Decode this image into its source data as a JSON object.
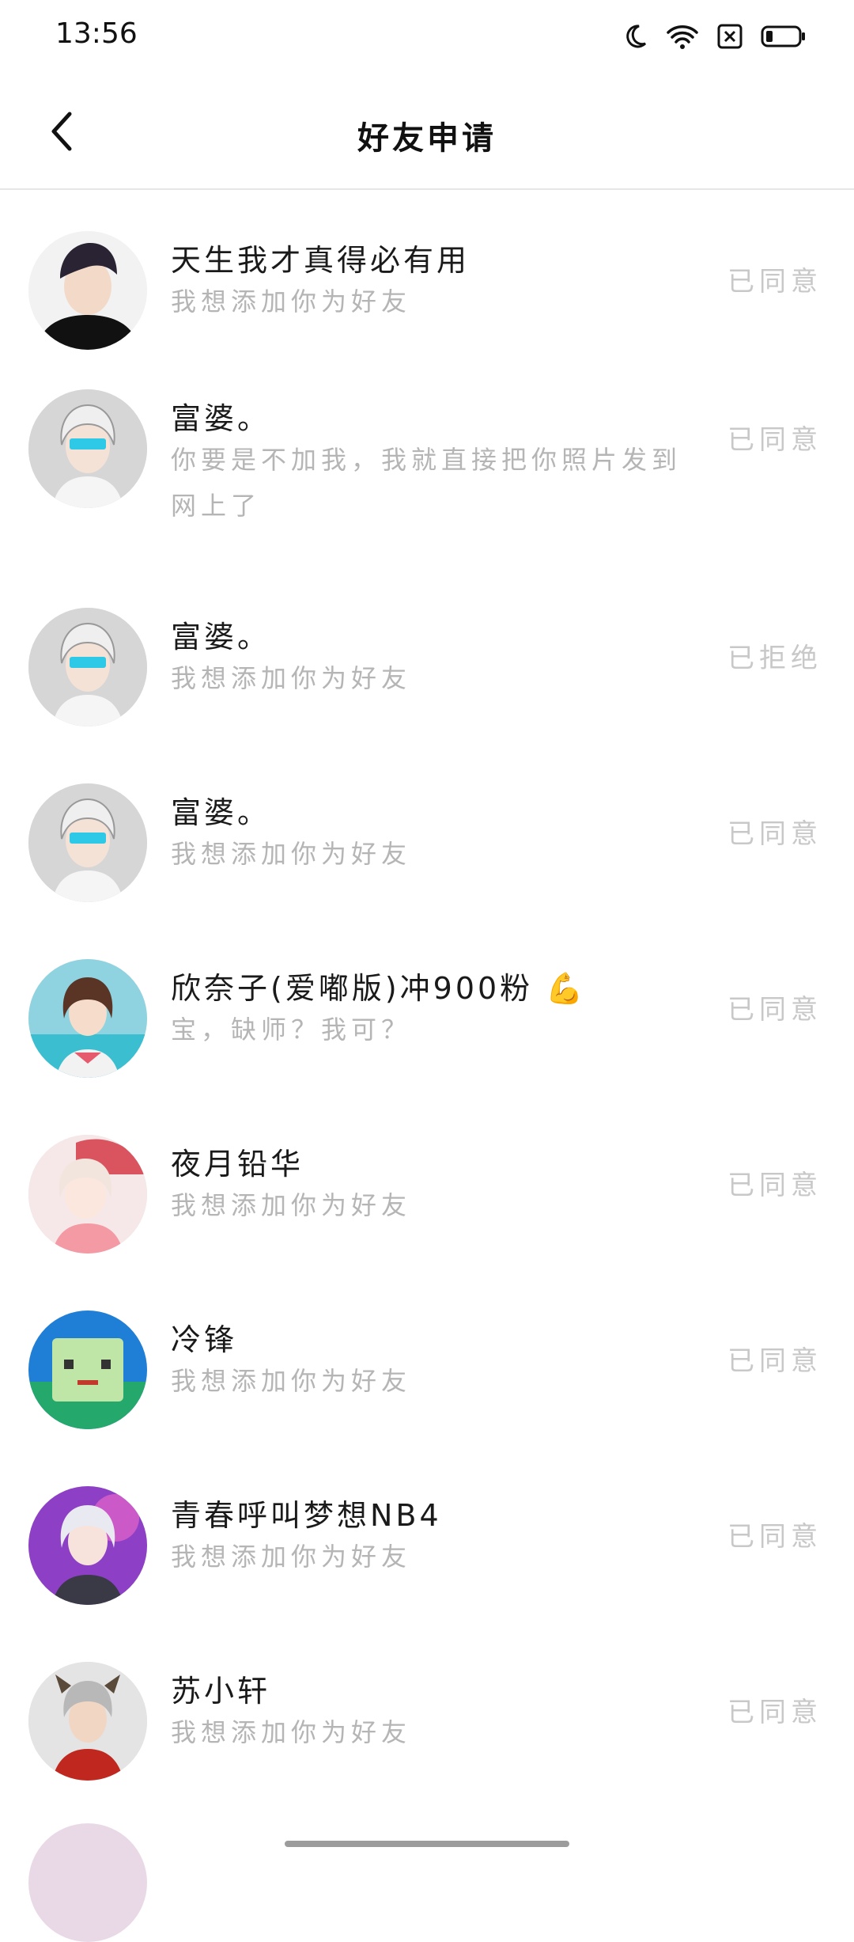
{
  "status_bar": {
    "time": "13:56",
    "icons": [
      "moon-icon",
      "wifi-icon",
      "sim-off-icon",
      "battery-icon"
    ]
  },
  "header": {
    "title": "好友申请",
    "back_icon": "chevron-left-icon"
  },
  "requests": [
    {
      "name": "天生我才真得必有用",
      "message": "我想添加你为好友",
      "status": "已同意"
    },
    {
      "name": "富婆。",
      "message": "你要是不加我，我就直接把你照片发到网上了",
      "status": "已同意"
    },
    {
      "name": "富婆。",
      "message": "我想添加你为好友",
      "status": "已拒绝"
    },
    {
      "name": "富婆。",
      "message": "我想添加你为好友",
      "status": "已同意"
    },
    {
      "name": "欣奈子(爱嘟版)冲900粉 💪",
      "message": "宝，缺师？我可？",
      "status": "已同意"
    },
    {
      "name": "夜月铅华",
      "message": "我想添加你为好友",
      "status": "已同意"
    },
    {
      "name": "冷锋",
      "message": "我想添加你为好友",
      "status": "已同意"
    },
    {
      "name": "青春呼叫梦想NB4",
      "message": "我想添加你为好友",
      "status": "已同意"
    },
    {
      "name": "苏小轩",
      "message": "我想添加你为好友",
      "status": "已同意"
    }
  ],
  "colors": {
    "background": "#ffffff",
    "name_text": "#1a1a1a",
    "secondary_text": "#b5b5b5",
    "status_text": "#c8c8c8",
    "divider": "#e6e6e6"
  }
}
